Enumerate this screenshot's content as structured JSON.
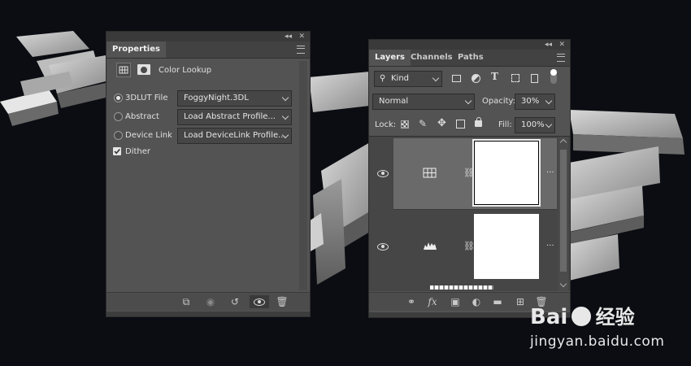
{
  "properties_panel": {
    "tab_label": "Properties",
    "adjustment_title": "Color Lookup",
    "options": [
      {
        "label": "3DLUT File",
        "value": "FoggyNight.3DL",
        "selected": true
      },
      {
        "label": "Abstract",
        "value": "Load Abstract Profile...",
        "selected": false
      },
      {
        "label": "Device Link",
        "value": "Load DeviceLink Profile...",
        "selected": false
      }
    ],
    "dither_label": "Dither",
    "dither_checked": true
  },
  "layers_panel": {
    "tabs": [
      "Layers",
      "Channels",
      "Paths"
    ],
    "filter_kind": "Kind",
    "blend_mode": "Normal",
    "opacity_label": "Opacity:",
    "opacity_value": "30%",
    "lock_label": "Lock:",
    "fill_label": "Fill:",
    "fill_value": "100%",
    "layers": [
      {
        "type": "color-lookup-adjustment",
        "visible": true,
        "selected": true,
        "more": "..."
      },
      {
        "type": "levels-adjustment",
        "visible": true,
        "selected": false,
        "more": "..."
      }
    ]
  },
  "watermark": {
    "logo_text": "Bai",
    "logo_text_cn": "经验",
    "url": "jingyan.baidu.com"
  },
  "colors": {
    "panel_bg": "#535353",
    "selected_row": "#6a6a6a",
    "background": "#0b0d12"
  }
}
